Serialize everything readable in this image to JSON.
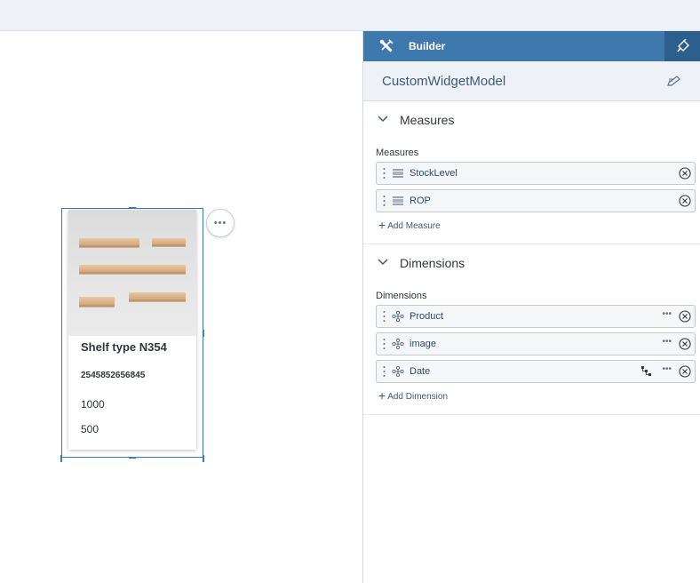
{
  "widget": {
    "title": "Shelf type N354",
    "id": "2545852656845",
    "value1": "1000",
    "value2": "500",
    "more_label": "•••"
  },
  "builder": {
    "header_title": "Builder",
    "model_name": "CustomWidgetModel",
    "sections": {
      "measures": {
        "heading": "Measures",
        "sublabel": "Measures",
        "items": [
          {
            "label": "StockLevel"
          },
          {
            "label": "ROP"
          }
        ],
        "add_label": "Add Measure"
      },
      "dimensions": {
        "heading": "Dimensions",
        "sublabel": "Dimensions",
        "items": [
          {
            "label": "Product",
            "more": "•••"
          },
          {
            "label": "image",
            "more": "•••"
          },
          {
            "label": "Date",
            "more": "•••"
          }
        ],
        "add_label": "Add Dimension"
      }
    }
  },
  "colors": {
    "header_bg": "#3f78ad",
    "header_active_bg": "#2d5f8c",
    "selection_border": "#3b7cb5",
    "link_text": "#3d5a7a"
  },
  "icons": {
    "builder": "tools-icon",
    "styling": "paintbrush-icon",
    "model_edit": "edit-model-icon",
    "measure": "measure-icon",
    "dimension": "dimension-icon",
    "hierarchy": "hierarchy-icon",
    "remove": "remove-circle-icon",
    "collapse": "chevron-down-icon"
  }
}
